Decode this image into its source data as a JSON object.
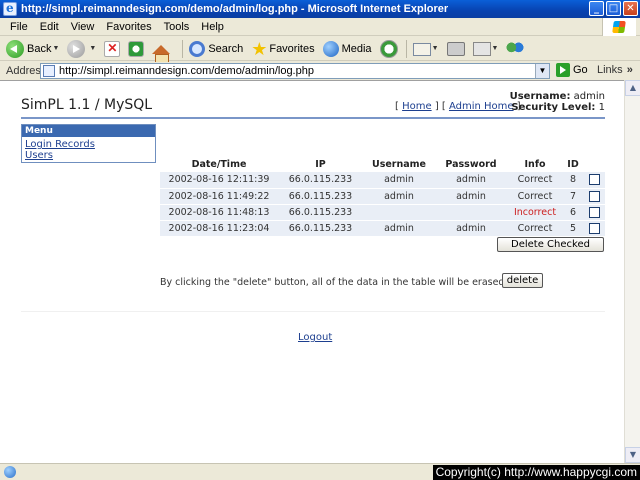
{
  "window": {
    "title": "http://simpl.reimanndesign.com/demo/admin/log.php - Microsoft Internet Explorer",
    "min": "_",
    "max": "□",
    "close": "✕"
  },
  "menu": [
    "File",
    "Edit",
    "View",
    "Favorites",
    "Tools",
    "Help"
  ],
  "toolbar": {
    "back": "Back",
    "search": "Search",
    "favorites": "Favorites",
    "media": "Media"
  },
  "address": {
    "label": "Address",
    "url": "http://simpl.reimanndesign.com/demo/admin/log.php",
    "go": "Go",
    "links": "Links",
    "links_chevron": "»"
  },
  "page": {
    "site_title": "SimPL 1.1 / MySQL",
    "nav": {
      "open1": "[",
      "home": "Home",
      "mid": "] [",
      "admin_home": "Admin Home",
      "close": "]"
    },
    "user": {
      "username_label": "Username:",
      "username": "admin",
      "security_label": "Security Level:",
      "security_level": "1"
    },
    "menu": {
      "header": "Menu",
      "items": [
        "Login Records",
        "Users"
      ]
    },
    "table": {
      "headers": [
        "Date/Time",
        "IP",
        "Username",
        "Password",
        "Info",
        "ID"
      ],
      "rows": [
        {
          "datetime": "2002-08-16 12:11:39",
          "ip": "66.0.115.233",
          "username": "admin",
          "password": "admin",
          "info": "Correct",
          "id": "8"
        },
        {
          "datetime": "2002-08-16 11:49:22",
          "ip": "66.0.115.233",
          "username": "admin",
          "password": "admin",
          "info": "Correct",
          "id": "7"
        },
        {
          "datetime": "2002-08-16 11:48:13",
          "ip": "66.0.115.233",
          "username": "",
          "password": "",
          "info": "Incorrect",
          "id": "6"
        },
        {
          "datetime": "2002-08-16 11:23:04",
          "ip": "66.0.115.233",
          "username": "admin",
          "password": "admin",
          "info": "Correct",
          "id": "5"
        }
      ]
    },
    "delete_checked": "Delete Checked",
    "note": "By clicking the \"delete\" button, all of the data in the table will be erased.",
    "delete": "delete",
    "logout": "Logout"
  },
  "copyright": "Copyright(c) http://www.happycgi.com"
}
